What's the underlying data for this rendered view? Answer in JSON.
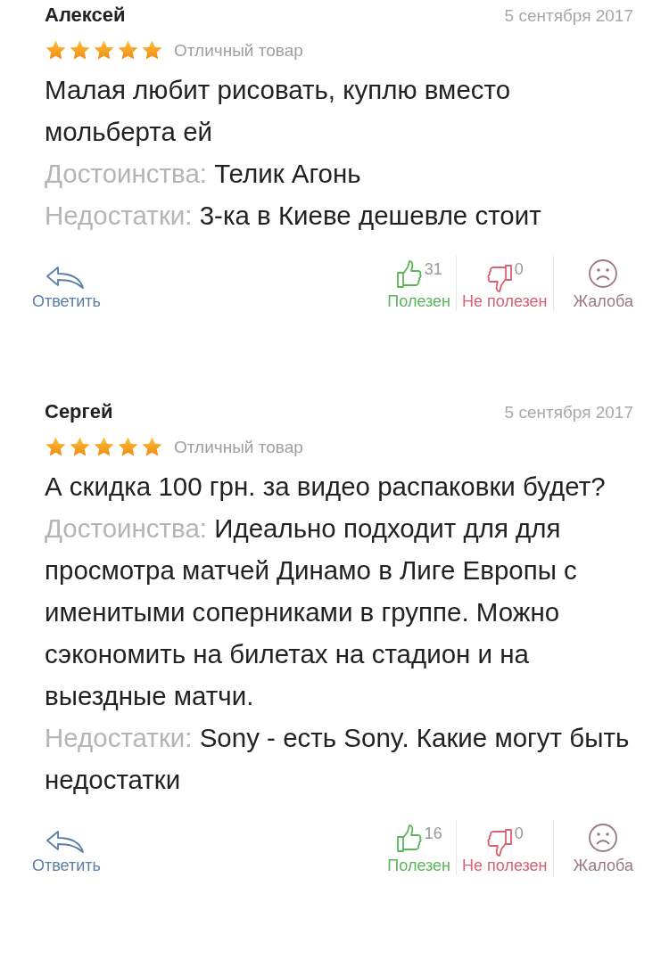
{
  "reviews": [
    {
      "author": "Алексей",
      "date": "5 сентября 2017",
      "stars": 5,
      "verdict": "Отличный товар",
      "text": "Малая любит рисовать, куплю вместо мольберта ей",
      "pros_label": "Достоинства:",
      "pros": "Телик Агонь",
      "cons_label": "Недостатки:",
      "cons": "3-ка в Киеве дешевле стоит",
      "reply": "Ответить",
      "useful": "Полезен",
      "useful_count": "31",
      "not_useful": "Не полезен",
      "not_useful_count": "0",
      "complaint": "Жалоба"
    },
    {
      "author": "Сергей",
      "date": "5 сентября 2017",
      "stars": 5,
      "verdict": "Отличный товар",
      "text": "А скидка 100 грн. за видео распаковки будет?",
      "pros_label": "Достоинства:",
      "pros": "Идеально подходит для для просмотра матчей Динамо в Лиге Европы с именитыми соперниками в группе. Можно сэкономить на билетах на стадион и на выездные матчи.",
      "cons_label": "Недостатки:",
      "cons": "Sony - есть Sony. Какие могут быть недостатки",
      "reply": "Ответить",
      "useful": "Полезен",
      "useful_count": "16",
      "not_useful": "Не полезен",
      "not_useful_count": "0",
      "complaint": "Жалоба"
    }
  ]
}
